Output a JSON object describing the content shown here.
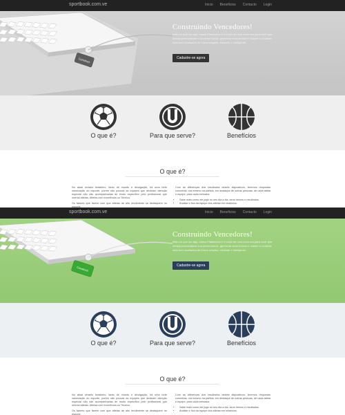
{
  "colors": {
    "accent_variant_a": "#333333",
    "accent_variant_b": "#2a3d5a",
    "hero_a": "#c9c9c9",
    "hero_b": "#9ccf7c",
    "strip_a": "#efefef",
    "strip_b": "#edf0f2"
  },
  "nav": {
    "brand": "sportbook.com.ve",
    "items": [
      "Inicio",
      "Beneficios",
      "Contacto",
      "Login"
    ]
  },
  "hero": {
    "title": "Construindo Vencedores!",
    "text": "Mais do que um app, nossa Plataforma é o início de uma nova era para você que deseja potencializar sua performance, gerenciar seus treinos e manter o controle total dos resultados de forma simples, eficiente e inteligente.",
    "cta": "Cadastre-se agora",
    "key_label": "Construct"
  },
  "features": [
    {
      "label": "O que é?",
      "icon": "soccer-ball-icon"
    },
    {
      "label": "Para que serve?",
      "icon": "horseshoe-icon"
    },
    {
      "label": "Benefícios",
      "icon": "basketball-icon"
    }
  ],
  "section": {
    "title": "O que é?",
    "col1_p1": "No atual cenário brasileiro, tanto de mundo e divulgação, há uma forte valorização do esporte, porém são poucas as equipes que dedicam atenção especial não são acompanhadas de modo específico pelo profissional que orienta atletas. Atletas com excelência ou Técnico.",
    "col1_p2": "Os fatores que fazem com que atletas de alto rendimento se destaquem no esporte.",
    "col2_p1": "Com as diferenças dos resultados destes dispositivos, teremos respostas concretas, ora mesmo na partida, em destaque de outras pessoas, de cada atleta e equipe, para cada treinador.",
    "col2_items": [
      "Sabe mais como ele joga no seu dia a dia, seus treinos e resultados.",
      "Análise e fica da equipe dos atletas em relatórios."
    ]
  }
}
